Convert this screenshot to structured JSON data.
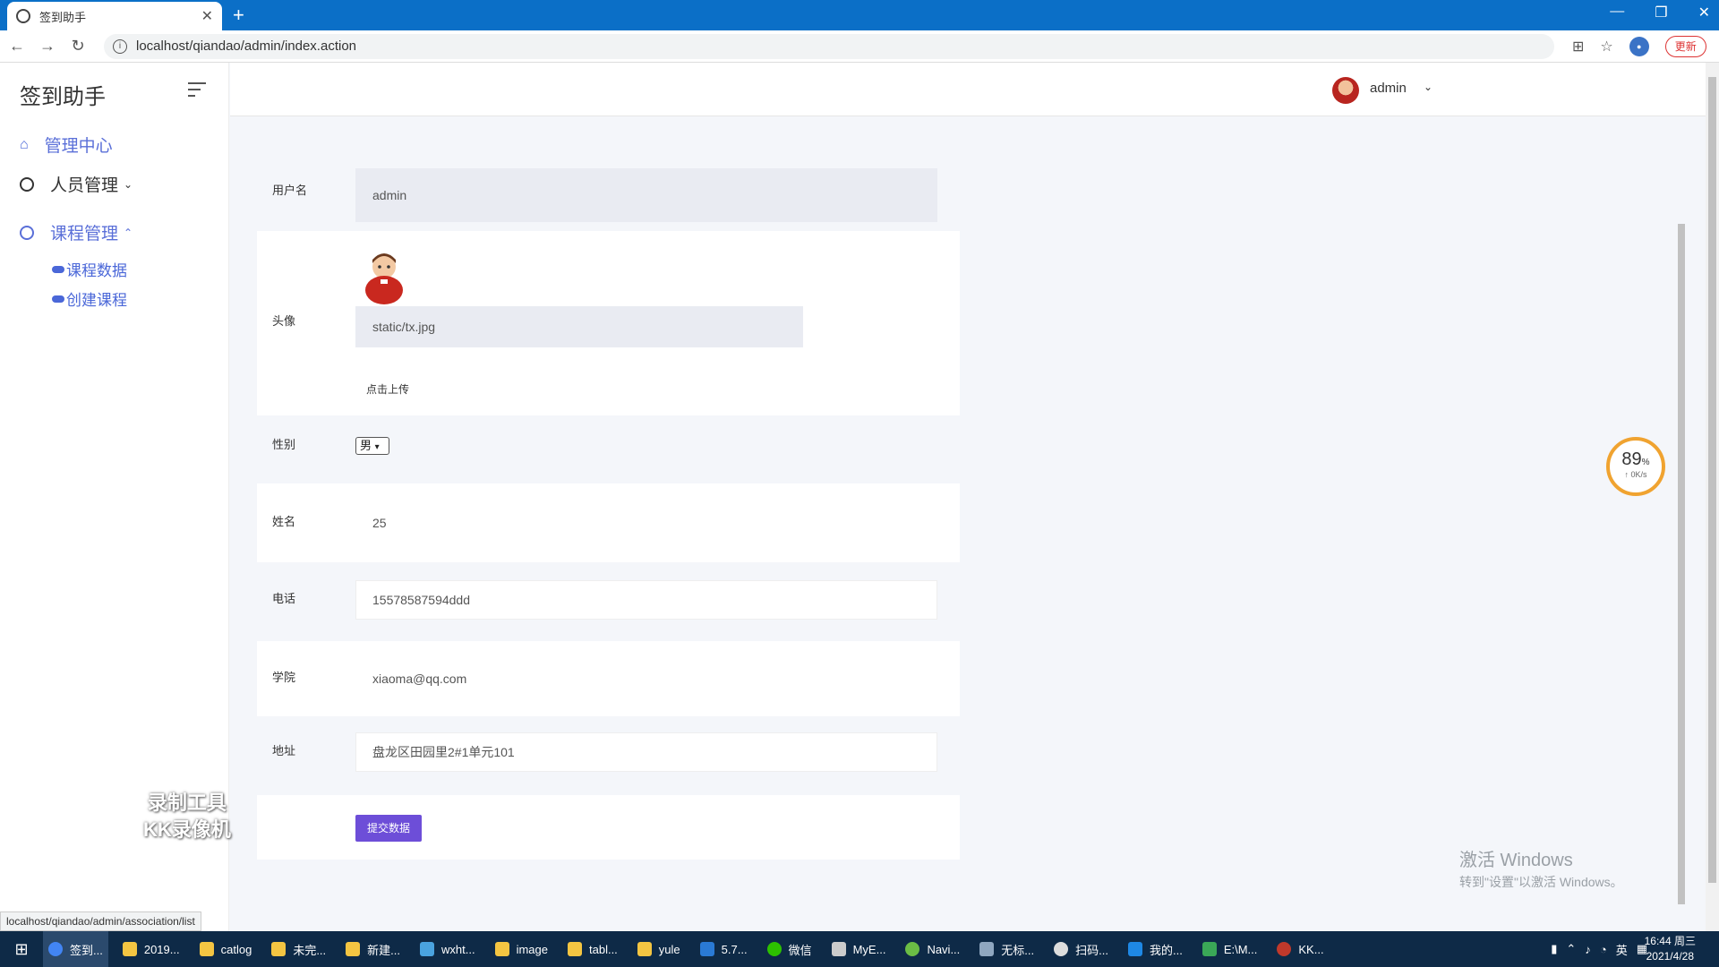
{
  "browser": {
    "tab_title": "签到助手",
    "new_tab": "+",
    "url": "localhost/qiandao/admin/index.action",
    "update_label": "更新",
    "status_url": "localhost/qiandao/admin/association/list"
  },
  "sidebar": {
    "brand": "签到助手",
    "items": [
      {
        "label": "管理中心"
      },
      {
        "label": "人员管理"
      },
      {
        "label": "课程管理"
      }
    ],
    "subitems": [
      {
        "label": "课程数据"
      },
      {
        "label": "创建课程"
      }
    ]
  },
  "header": {
    "username": "admin"
  },
  "form": {
    "username_label": "用户名",
    "username_value": "admin",
    "avatar_label": "头像",
    "avatar_value": "static/tx.jpg",
    "upload_label": "点击上传",
    "gender_label": "性别",
    "gender_value": "男",
    "name_label": "姓名",
    "name_value": "25",
    "phone_label": "电话",
    "phone_value": "15578587594ddd",
    "college_label": "学院",
    "college_value": "xiaoma@qq.com",
    "address_label": "地址",
    "address_value": "盘龙区田园里2#1单元101",
    "submit_label": "提交数据"
  },
  "gauge": {
    "percent": "89",
    "unit": "%",
    "speed": "↑ 0K/s"
  },
  "watermark": {
    "win_line1": "激活 Windows",
    "win_line2": "转到\"设置\"以激活 Windows。",
    "kk_line1": "录制工具",
    "kk_line2": "KK录像机"
  },
  "taskbar": {
    "tasks": [
      "签到...",
      "2019...",
      "catlog",
      "未完...",
      "新建...",
      "wxht...",
      "image",
      "tabl...",
      "yule",
      "5.7...",
      "微信",
      "MyE...",
      "Navi...",
      "无标...",
      "扫码...",
      "我的...",
      "E:\\M...",
      "KK..."
    ],
    "ime": "英",
    "time": "16:44 周三",
    "date": "2021/4/28"
  }
}
